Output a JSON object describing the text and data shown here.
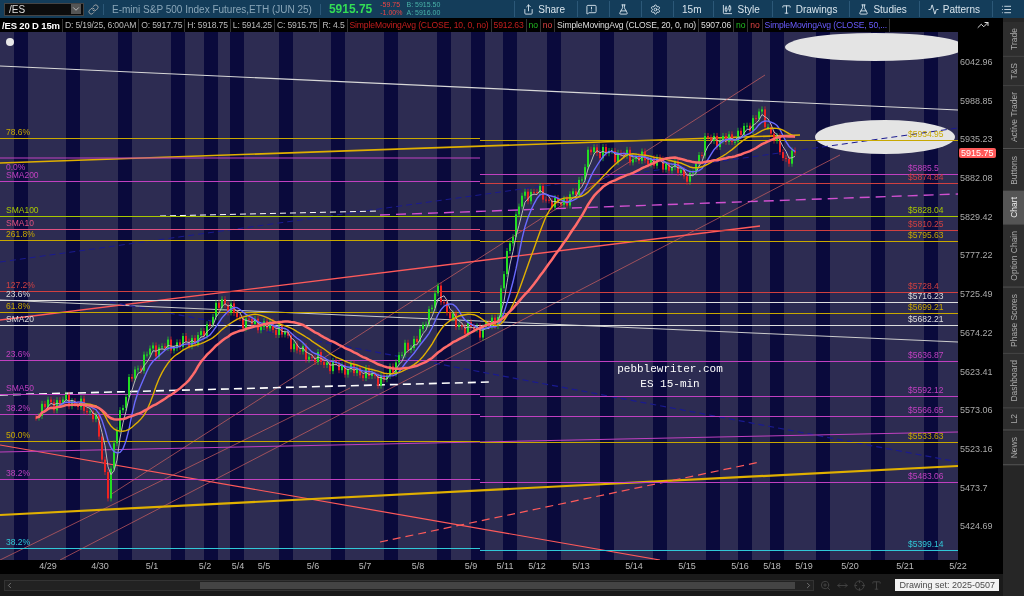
{
  "toolbar": {
    "symbol": "/ES",
    "description": "E-mini S&P 500 Index Futures,ETH (JUN 25)",
    "last": "5915.75",
    "change": "-59.75",
    "change_pct": "-1.00%",
    "bid": "B: 5915.50",
    "ask": "A: 5916.00",
    "buttons": [
      {
        "kind": "share",
        "label": "Share"
      },
      {
        "kind": "message"
      },
      {
        "kind": "flask"
      },
      {
        "kind": "gear"
      },
      {
        "kind": "interval",
        "label": "15m"
      },
      {
        "kind": "style",
        "label": "Style"
      },
      {
        "kind": "drawings",
        "label": "Drawings"
      },
      {
        "kind": "studies",
        "label": "Studies"
      },
      {
        "kind": "patterns",
        "label": "Patterns"
      },
      {
        "kind": "menu"
      }
    ]
  },
  "info_bar": [
    {
      "text": "/ES 20 D 15m",
      "kind": "title"
    },
    {
      "text": "D: 5/19/25, 6:00AM",
      "kind": "field"
    },
    {
      "text": "O: 5917.75",
      "kind": "field"
    },
    {
      "text": "H: 5918.75",
      "kind": "field"
    },
    {
      "text": "L: 5914.25",
      "kind": "field"
    },
    {
      "text": "C: 5915.75",
      "kind": "field"
    },
    {
      "text": "R: 4.5",
      "kind": "field"
    },
    {
      "text": "SimpleMovingAvg (CLOSE, 10, 0, no)",
      "kind": "sma10"
    },
    {
      "text": "5912.63",
      "kind": "sma10"
    },
    {
      "text": "no",
      "kind": "flag_green"
    },
    {
      "text": "no",
      "kind": "flag_red"
    },
    {
      "text": "SimpleMovingAvg (CLOSE, 20, 0, no)",
      "kind": "sma20"
    },
    {
      "text": "5907.06",
      "kind": "sma20"
    },
    {
      "text": "no",
      "kind": "flag_green"
    },
    {
      "text": "no",
      "kind": "flag_red"
    },
    {
      "text": "SimpleMovingAvg (CLOSE, 50,...",
      "kind": "sma50"
    }
  ],
  "chart": {
    "annotation": [
      "pebblewriter.com",
      "ES 15-min"
    ],
    "left_labels": [
      "78.6%",
      "0.0%",
      "SMA200",
      "SMA100",
      "SMA10",
      "261.8%",
      "127.2%",
      "23.6%",
      "61.8%",
      "SMA20",
      "23.6%",
      "SMA50",
      "38.2%",
      "50.0%",
      "38.2%",
      "38.2%"
    ],
    "right_labels": [
      "$5934.95",
      "$5885.5",
      "$5874.84",
      "$5828.04",
      "$5810.25",
      "$5795.63",
      "$5728.4",
      "$5716.23",
      "$5699.21",
      "$5682.21",
      "$5636.87",
      "$5592.12",
      "$5566.65",
      "$5533.63",
      "$5483.06",
      "$5399.14"
    ],
    "price_axis": [
      "6042.96",
      "5988.85",
      "5935.23",
      "5882.08",
      "5829.42",
      "5777.22",
      "5725.49",
      "5674.22",
      "5623.41",
      "5573.06",
      "5523.16",
      "5473.7",
      "5424.69"
    ],
    "last_price": "5915.75",
    "date_axis": [
      "4/29",
      "4/30",
      "5/1",
      "5/2",
      "5/4",
      "5/5",
      "5/6",
      "5/7",
      "5/8",
      "5/9",
      "5/11",
      "5/12",
      "5/13",
      "5/14",
      "5/15",
      "5/16",
      "5/18",
      "5/19",
      "5/20",
      "5/21",
      "5/22"
    ]
  },
  "footer": {
    "drawing_set": "Drawing set: 2025-0507"
  },
  "sidebar": {
    "tabs": [
      {
        "label": "Trade",
        "selected": false
      },
      {
        "label": "T&S",
        "selected": false
      },
      {
        "label": "Active Trader",
        "selected": false
      },
      {
        "label": "Buttons",
        "selected": false
      },
      {
        "label": "Chart",
        "selected": true
      },
      {
        "label": "Option Chain",
        "selected": false
      },
      {
        "label": "Phase Scores",
        "selected": false
      },
      {
        "label": "Dashboard",
        "selected": false
      },
      {
        "label": "L2",
        "selected": false
      },
      {
        "label": "News",
        "selected": false
      }
    ]
  }
}
